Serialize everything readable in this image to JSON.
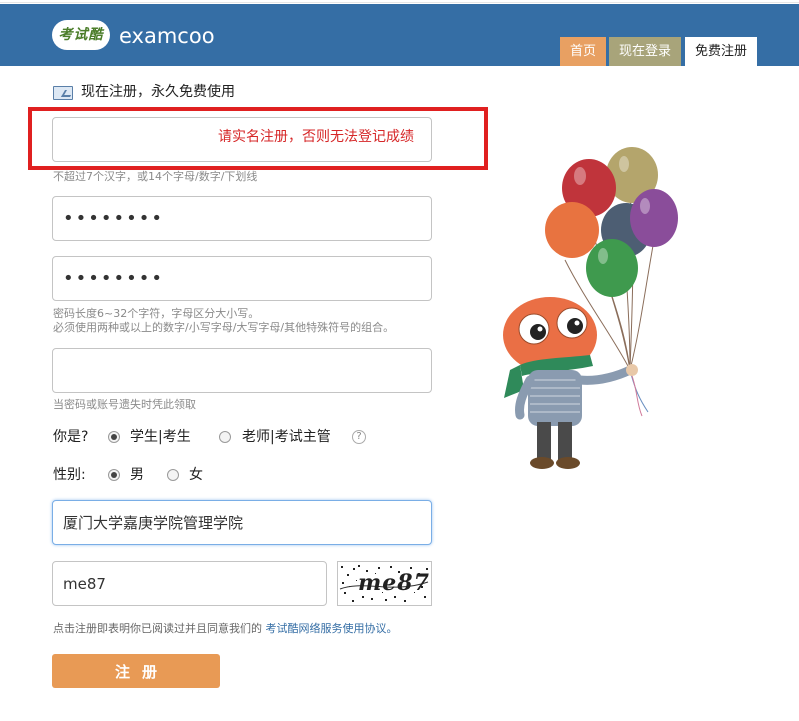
{
  "header": {
    "logo_badge": "考试酷",
    "logo_text": "examcoo",
    "tabs": [
      {
        "label": "首页"
      },
      {
        "label": "现在登录"
      },
      {
        "label": "免费注册"
      }
    ]
  },
  "form": {
    "intro": "现在注册，永久免费使用",
    "name": {
      "value": "",
      "warning": "请实名注册，否则无法登记成绩",
      "hint": "不超过7个汉字，或14个字母/数字/下划线"
    },
    "password": {
      "value": "••••••••"
    },
    "password_confirm": {
      "value": "••••••••"
    },
    "password_hint_1": "密码长度6~32个字符，字母区分大小写。",
    "password_hint_2": "必须使用两种或以上的数字/小写字母/大写字母/其他特殊符号的组合。",
    "recovery": {
      "value": "",
      "hint": "当密码或账号遗失时凭此领取"
    },
    "role": {
      "label": "你是?",
      "options": [
        "学生|考生",
        "老师|考试主管"
      ],
      "selected": "学生|考生",
      "help": "?"
    },
    "gender": {
      "label": "性别:",
      "options": [
        "男",
        "女"
      ],
      "selected": "男"
    },
    "school": {
      "value": "厦门大学嘉庚学院管理学院"
    },
    "captcha": {
      "value": "me87",
      "image_text": "me87"
    },
    "agreement": {
      "text": "点击注册即表明你已阅读过并且同意我们的",
      "link": "考试酷网络服务使用协议。"
    },
    "submit_label": "注册"
  },
  "colors": {
    "header_bg": "#356ea5",
    "tab_home": "#e8a062",
    "tab_login": "#a8a47a",
    "submit": "#e89a55",
    "warning": "#d62728"
  }
}
